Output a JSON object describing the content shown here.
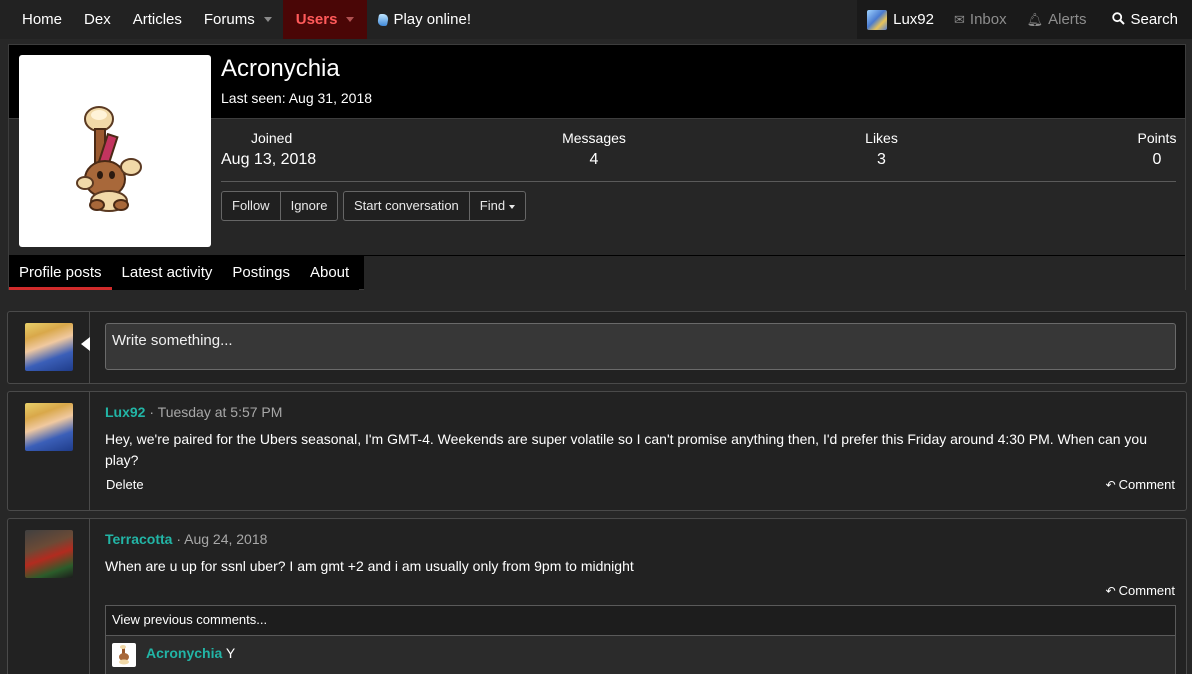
{
  "nav": {
    "items": [
      {
        "label": "Home"
      },
      {
        "label": "Dex"
      },
      {
        "label": "Articles"
      },
      {
        "label": "Forums"
      },
      {
        "label": "Users"
      },
      {
        "label": "Play online!"
      }
    ],
    "right": {
      "account_label": "Lux92",
      "inbox_label": "Inbox",
      "alerts_label": "Alerts",
      "search_label": "Search"
    }
  },
  "profile": {
    "name": "Acronychia",
    "last_seen": "Last seen: Aug 31, 2018",
    "stats": {
      "joined_label": "Joined",
      "joined_value": "Aug 13, 2018",
      "messages_label": "Messages",
      "messages_value": "4",
      "likes_label": "Likes",
      "likes_value": "3",
      "points_label": "Points",
      "points_value": "0"
    },
    "buttons": {
      "follow": "Follow",
      "ignore": "Ignore",
      "start_conversation": "Start conversation",
      "find": "Find"
    },
    "tabs": [
      "Profile posts",
      "Latest activity",
      "Postings",
      "About"
    ]
  },
  "composer": {
    "placeholder": "Write something..."
  },
  "posts": [
    {
      "user": "Lux92",
      "meta": " · Tuesday at 5:57 PM",
      "body": "Hey, we're paired for the Ubers seasonal, I'm GMT-4. Weekends are super volatile so I can't promise anything then, I'd prefer this Friday around 4:30 PM. When can you play?",
      "delete_label": "Delete",
      "comment_label": "Comment"
    },
    {
      "user": "Terracotta",
      "meta": " · Aug 24, 2018",
      "body": "When are u up for ssnl uber? I am gmt +2 and i am usually only from 9pm to midnight",
      "comment_label": "Comment",
      "view_previous": "View previous comments...",
      "comments": [
        {
          "user": "Acronychia",
          "text": " Y"
        }
      ]
    }
  ],
  "colors": {
    "accent_active_nav": "#4a0606",
    "username": "#22b5a6",
    "tab_underline": "#d12b2b"
  },
  "icons": {
    "inbox": "envelope-icon",
    "alerts": "bell-icon",
    "search": "search-icon",
    "reply": "reply-icon"
  }
}
